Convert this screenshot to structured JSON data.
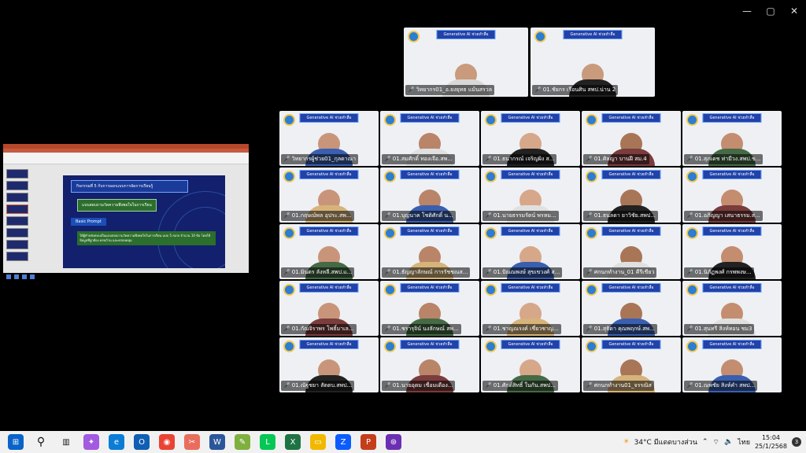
{
  "window_controls": {
    "minimize": "—",
    "maximize": "▢",
    "close": "✕"
  },
  "slide": {
    "title": "กิจกรรมที่ 5 ก้บการออกแบบการจัดการเรียนรู้",
    "subtitle": "แบบสอบถามวัดความพึงพอใจในการเรียน",
    "button": "Basic Prompt",
    "body": "ให้ผู้ทำหลังคบบเป็นแบบสอบถามวัดความพึงพอใจในการเรียน แบบ 5 สเกล จำนวน 10 ข้อ โดยให้ข้อมูลที่ถูกต้อง ครบถ้วน และครอบคลุม"
  },
  "banner": "Generative AI ช่วยทำสื่อ",
  "top_participants": [
    {
      "name": "วิทยากร01_อ.ยงยุทธ แม้นสรวล"
    },
    {
      "name": "01.ชัยกร เรือนศิน สพป.น่าน 2"
    }
  ],
  "participants": [
    {
      "name": "วิทยากรผู้ช่วย01_กุลดาณา"
    },
    {
      "name": "01.สมศักดิ์ ทองเจือ.สพ..."
    },
    {
      "name": "01.ธนากรณ์ เจริญผิง ส..."
    },
    {
      "name": "01.ศิลญา บานฝี สม.4"
    },
    {
      "name": "01.สุภเดช ท่ามีวง.สพป.ข..."
    },
    {
      "name": "01.กฤษณ์พล อุประ.สพ..."
    },
    {
      "name": "01.บุญนาค โชติศักดิ์ น..."
    },
    {
      "name": "01.นายธรรมรัตน์ พรหม..."
    },
    {
      "name": "01.ธนลดา ยาวิชัย.สพป..."
    },
    {
      "name": "01.อภิญญา เสนาธรรม.ส..."
    },
    {
      "name": "01.มินตร ลังหลี.สพป.แ..."
    },
    {
      "name": "01.ธัญญาลักษณ์ การรัชชณส..."
    },
    {
      "name": "01.ปัณณพงษ์ สุขเขวงศ์ ส..."
    },
    {
      "name": "ศกนกทำงาน_01 คีรีเขียว"
    },
    {
      "name": "01.นิภัฏพงศ์ กรพพงษ..."
    },
    {
      "name": "01.กัณจิราพร โพธิ์มาเล..."
    },
    {
      "name": "01.ชรารุจิน์ นงลักษณ์ สพ..."
    },
    {
      "name": "01.ชาญณรงค์ เชี่ยวชาญ..."
    },
    {
      "name": "01.สุธิดา คุณพฤกษ์.สพ..."
    },
    {
      "name": "01.สุนทรี สิงห์ทอน ชม3"
    },
    {
      "name": "01.ณัฐชยา สัตตบ.สพป..."
    },
    {
      "name": "01.นายอุดม เชื่อมเดือง..."
    },
    {
      "name": "01.ศักดิ์สิทธิ์ ในกัน.สพป..."
    },
    {
      "name": "ศกนกทำงาน01_จรรณิส"
    },
    {
      "name": "01.ณพชัย สิงห์คำ สพป..."
    }
  ],
  "taskbar": {
    "weather": "34°C มีแดดบางส่วน",
    "language": "ไทย",
    "time": "15:04",
    "date": "25/1/2568",
    "notifications": "3"
  }
}
